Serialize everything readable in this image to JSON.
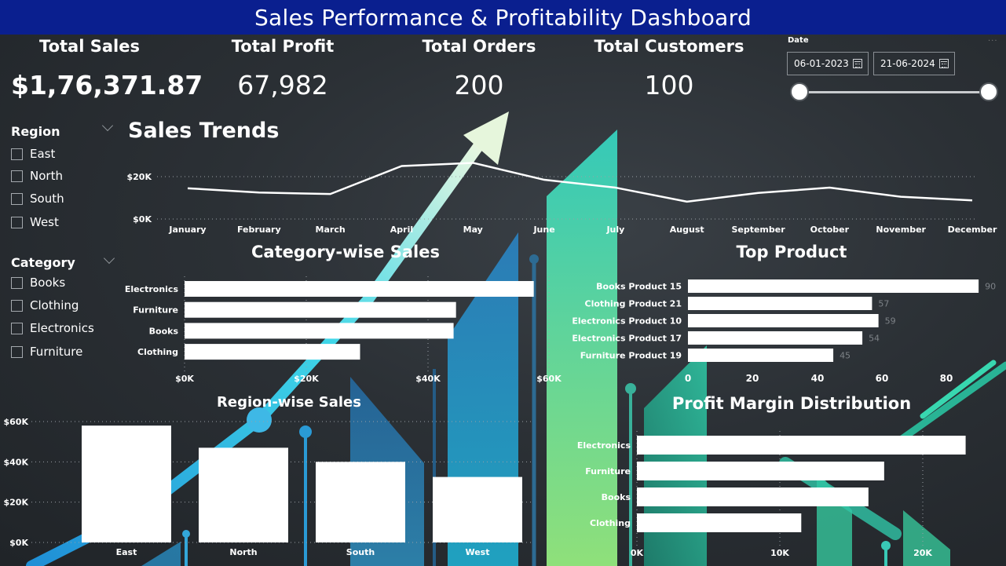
{
  "header": {
    "title": "Sales Performance & Profitability Dashboard"
  },
  "kpis": [
    {
      "label": "Total Sales",
      "value": "$1,76,371.87"
    },
    {
      "label": "Total Profit",
      "value": "67,982"
    },
    {
      "label": "Total Orders",
      "value": "200"
    },
    {
      "label": "Total Customers",
      "value": "100"
    }
  ],
  "date_filter": {
    "label": "Date",
    "start": "06-01-2023",
    "end": "21-06-2024",
    "more_icon": "ellipsis-icon",
    "calendar_icon": "calendar-icon"
  },
  "region_slicer": {
    "title": "Region",
    "items": [
      "East",
      "North",
      "South",
      "West"
    ],
    "checked": [
      false,
      false,
      false,
      false
    ]
  },
  "category_slicer": {
    "title": "Category",
    "items": [
      "Books",
      "Clothing",
      "Electronics",
      "Furniture"
    ],
    "checked": [
      false,
      false,
      false,
      false
    ]
  },
  "colors": {
    "title_bar": "#0a1f8f",
    "bar_fill": "#ffffff",
    "line": "#ffffff",
    "muted_label": "#7d8287"
  },
  "chart_data": [
    {
      "id": "sales_trends",
      "type": "line",
      "title": "Sales Trends",
      "categories": [
        "January",
        "February",
        "March",
        "April",
        "May",
        "June",
        "July",
        "August",
        "September",
        "October",
        "November",
        "December"
      ],
      "values": [
        14500,
        12500,
        11800,
        25000,
        26500,
        18500,
        14800,
        8200,
        12300,
        14800,
        10500,
        8800
      ],
      "yticks": [
        "$0K",
        "$20K"
      ],
      "ylim": [
        0,
        40000
      ],
      "grid": true
    },
    {
      "id": "category_sales",
      "type": "bar",
      "orientation": "horizontal",
      "title": "Category-wise Sales",
      "categories": [
        "Electronics",
        "Furniture",
        "Books",
        "Clothing"
      ],
      "values": [
        57500,
        44700,
        44300,
        28900
      ],
      "xticks": [
        "$0K",
        "$20K",
        "$40K",
        "$60K"
      ],
      "xlim": [
        0,
        60000
      ],
      "grid": true
    },
    {
      "id": "top_product",
      "type": "bar",
      "orientation": "horizontal",
      "title": "Top Product",
      "categories": [
        "Books Product 15",
        "Clothing Product 21",
        "Electronics Product 10",
        "Electronics Product 17",
        "Furniture Product 19"
      ],
      "values": [
        90,
        57,
        59,
        54,
        45
      ],
      "labels": [
        "90",
        "57",
        "59",
        "54",
        "45"
      ],
      "xticks": [
        "0",
        "20",
        "40",
        "60",
        "80"
      ],
      "xlim": [
        0,
        90
      ]
    },
    {
      "id": "region_sales",
      "type": "bar",
      "orientation": "vertical",
      "title": "Region-wise Sales",
      "categories": [
        "East",
        "North",
        "South",
        "West"
      ],
      "values": [
        58000,
        47000,
        40000,
        32500
      ],
      "yticks": [
        "$0K",
        "$20K",
        "$40K",
        "$60K"
      ],
      "ylim": [
        0,
        60000
      ],
      "grid": true
    },
    {
      "id": "profit_margin",
      "type": "bar",
      "orientation": "horizontal",
      "title": "Profit Margin Distribution",
      "categories": [
        "Electronics",
        "Furniture",
        "Books",
        "Clothing"
      ],
      "values": [
        23000,
        17300,
        16200,
        11500
      ],
      "xticks": [
        "0K",
        "10K",
        "20K"
      ],
      "xlim": [
        0,
        20000
      ],
      "grid": true
    }
  ]
}
